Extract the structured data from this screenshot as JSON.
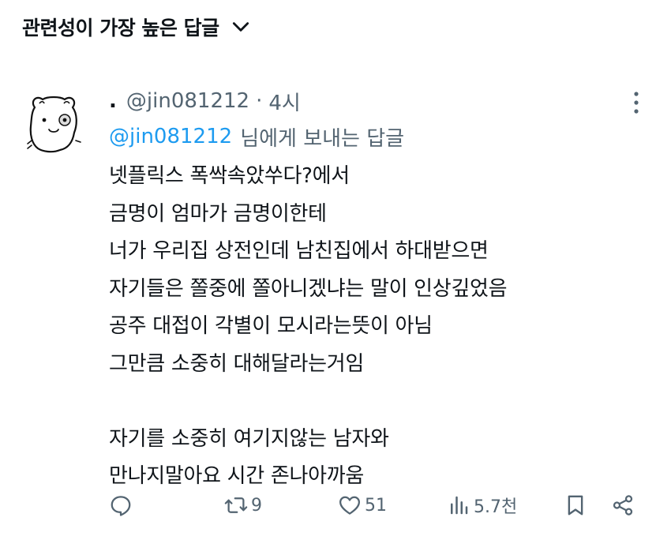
{
  "sort": {
    "label": "관련성이 가장 높은 답글",
    "icon": "chevron-down-icon"
  },
  "tweet": {
    "author_name": ".",
    "handle": "@jin081212",
    "separator": "·",
    "time": "4시",
    "replying_to": {
      "mention": "@jin081212",
      "suffix": "님에게 보내는 답글"
    },
    "body_lines": [
      "넷플릭스 폭싹속았쑤다?에서",
      "금명이 엄마가 금명이한테",
      "너가 우리집 상전인데 남친집에서 하대받으면",
      "자기들은 쫄중에 쫄아니겠냐는 말이 인상깊었음",
      "공주 대접이 각별이 모시라는뜻이 아님",
      "그만큼 소중히 대해달라는거임",
      "",
      "자기를 소중히 여기지않는 남자와",
      "만나지말아요 시간 존나아까움"
    ],
    "actions": {
      "reply_count": "",
      "retweet_count": "9",
      "like_count": "51",
      "view_count": "5.7천"
    }
  },
  "colors": {
    "text": "#0f1419",
    "muted": "#536471",
    "link": "#1d9bf0"
  }
}
